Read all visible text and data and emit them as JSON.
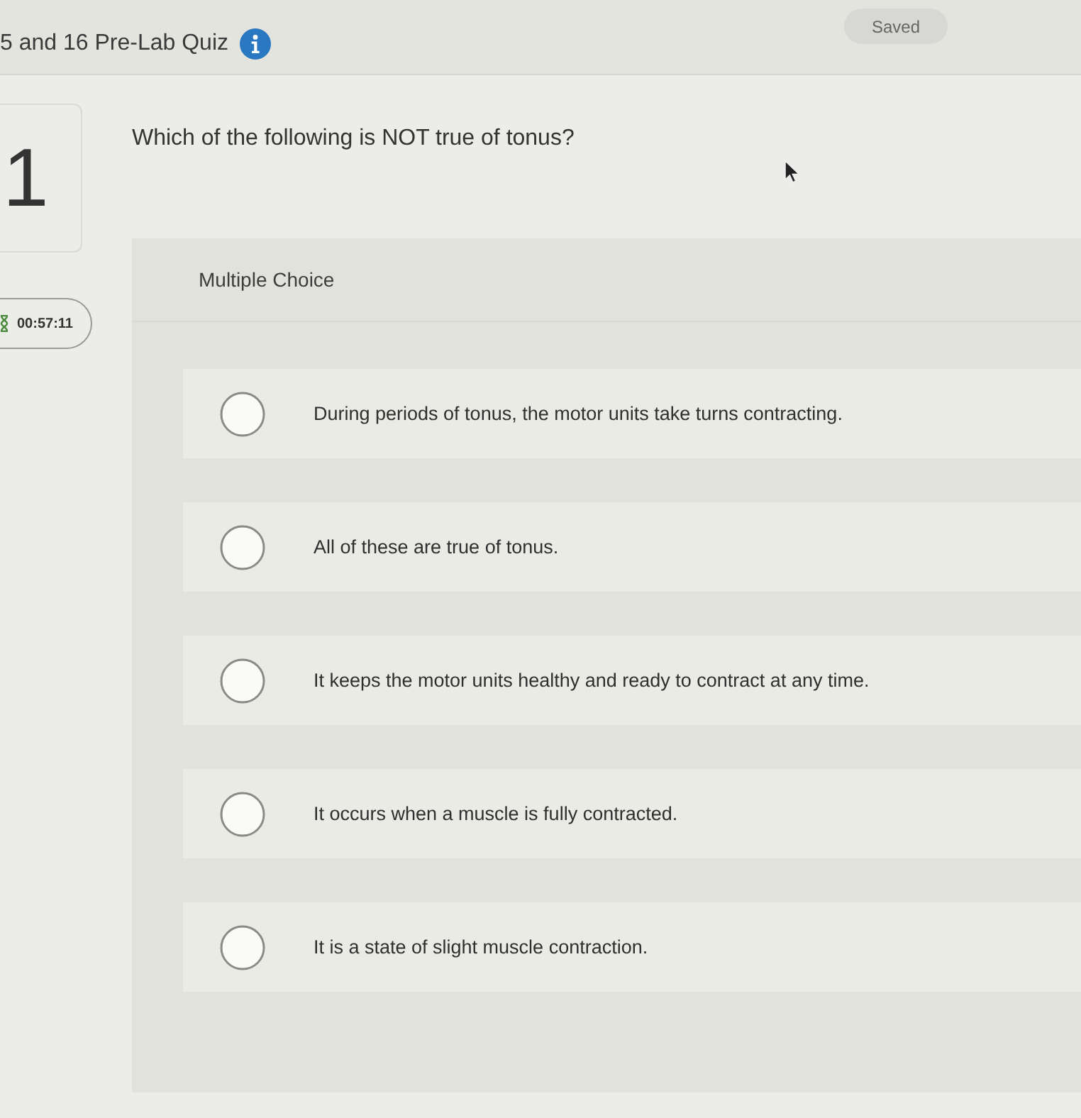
{
  "header": {
    "title": "5 and 16 Pre-Lab Quiz",
    "save_status": "Saved"
  },
  "question": {
    "number": "1",
    "timer": "00:57:11",
    "prompt": "Which of the following is NOT true of tonus?",
    "type_label": "Multiple Choice",
    "options": [
      {
        "text": "During periods of tonus, the motor units take turns contracting.",
        "selected": false
      },
      {
        "text": "All of these are true of tonus.",
        "selected": false
      },
      {
        "text": "It keeps the motor units healthy and ready to contract at any time.",
        "selected": false
      },
      {
        "text": "It occurs when a muscle is fully contracted.",
        "selected": false
      },
      {
        "text": "It is a state of slight muscle contraction.",
        "selected": false
      }
    ]
  }
}
